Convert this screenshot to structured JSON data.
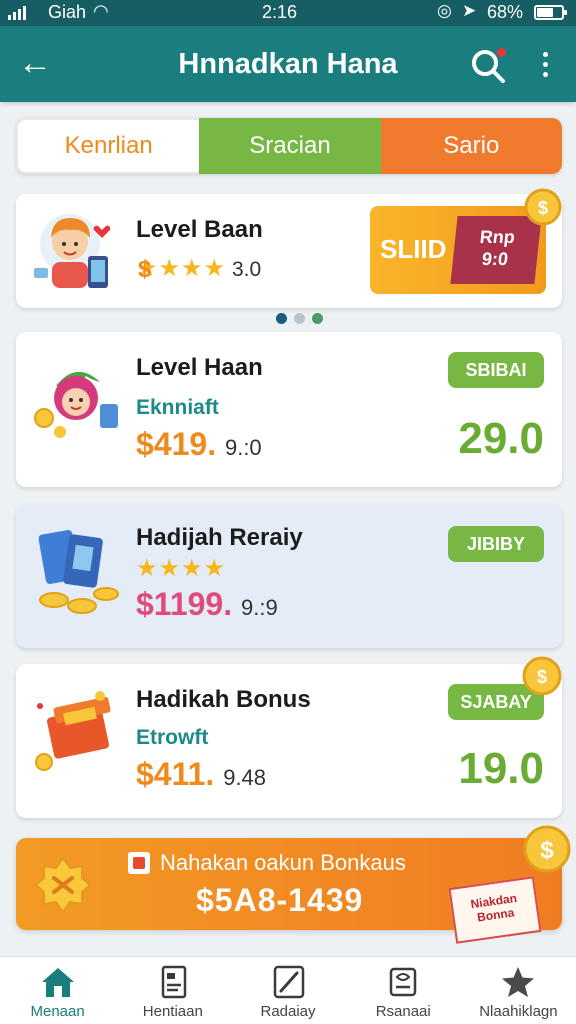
{
  "status_bar": {
    "carrier": "Giah",
    "time": "2:16",
    "battery": "68%",
    "battery_level": 0.68
  },
  "header": {
    "title": "Hnnadkan Hana",
    "back_icon": "back-arrow-icon",
    "search_icon": "search-icon",
    "more_icon": "more-vertical-icon"
  },
  "tabs": [
    {
      "label": "Kenrlian",
      "color": "#ef8a1d"
    },
    {
      "label": "Sracian",
      "color": "#76b843"
    },
    {
      "label": "Sario",
      "color": "#f07b2c"
    }
  ],
  "featured": {
    "name": "Level Baan",
    "rating": "3.0",
    "stars": 4,
    "banner_text": "SLIID",
    "banner_stamp": "Rnp\n9:0",
    "carousel_pages": 3,
    "carousel_active": 0
  },
  "items": [
    {
      "name": "Level Haan",
      "subtitle": "Eknniaft",
      "price_main": "$419.",
      "price_sub": "9.:0",
      "badge": "SBIBAI",
      "value": "29.0"
    },
    {
      "name": "Hadijah Reraiy",
      "stars": 4,
      "price_main": "$1199.",
      "price_sub": "9.:9",
      "badge": "JIBIBY",
      "value": ""
    },
    {
      "name": "Hadikah Bonus",
      "subtitle": "Etrowft",
      "price_main": "$411.",
      "price_sub": "9.48",
      "badge": "SJABAY",
      "value": "19.0"
    }
  ],
  "promo": {
    "line1": "Nahakan oakun Bonkaus",
    "line2": "$5A8-1439",
    "ticket_text": "Niakdan\nBonna"
  },
  "bottom_nav": [
    {
      "label": "Menaan",
      "icon": "home-icon",
      "active": true
    },
    {
      "label": "Hentiaan",
      "icon": "document-icon",
      "active": false
    },
    {
      "label": "Radaiay",
      "icon": "edit-icon",
      "active": false
    },
    {
      "label": "Rsanaai",
      "icon": "voucher-icon",
      "active": false
    },
    {
      "label": "Nlaahiklagn",
      "icon": "star-icon",
      "active": false
    }
  ],
  "colors": {
    "primary": "#1a7d7e",
    "green": "#76b843",
    "orange": "#f07b2c",
    "star": "#f5b71c"
  }
}
